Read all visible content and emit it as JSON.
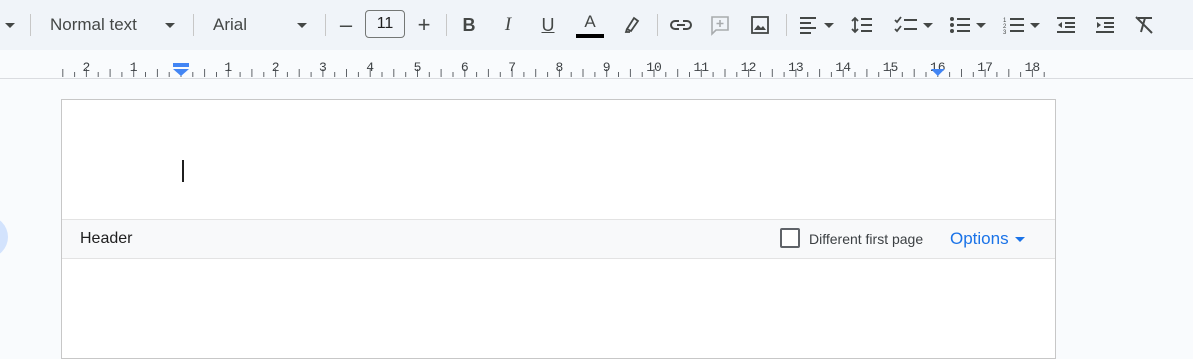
{
  "toolbar": {
    "style_select": "Normal text",
    "font_select": "Arial",
    "font_size": "11",
    "decrease_label": "–",
    "increase_label": "+",
    "bold": "B",
    "italic": "I",
    "underline": "U",
    "text_color": "A",
    "text_color_value": "#000000",
    "icons": [
      "highlighter-icon",
      "link-icon",
      "add-comment-icon",
      "insert-image-icon",
      "align-left-icon",
      "line-spacing-icon",
      "checklist-icon",
      "bulleted-list-icon",
      "numbered-list-icon",
      "decrease-indent-icon",
      "increase-indent-icon",
      "clear-formatting-icon"
    ]
  },
  "ruler": {
    "labels": [
      "2",
      "1",
      "1",
      "2",
      "3",
      "4",
      "5",
      "6",
      "7",
      "8",
      "9",
      "10",
      "11",
      "12",
      "13",
      "14",
      "15",
      "16",
      "17",
      "18"
    ],
    "marker_color": "#4285f4"
  },
  "header_bar": {
    "label": "Header",
    "different_first_page_label": "Different first page",
    "different_first_page_checked": false,
    "options_label": "Options",
    "options_color": "#1a73e8"
  }
}
